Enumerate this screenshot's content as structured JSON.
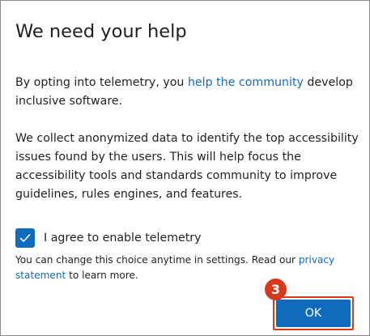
{
  "dialog": {
    "title": "We need your help",
    "paragraph1": {
      "before": "By opting into telemetry, you ",
      "link": "help the community",
      "after": " develop inclusive software."
    },
    "paragraph2": "We collect anonymized data to identify the top accessibility issues found by the users. This will help focus the accessibility tools and standards community to improve guidelines, rules engines, and features.",
    "checkbox": {
      "label": "I agree to enable telemetry",
      "checked": true
    },
    "note": {
      "before": "You can change this choice anytime in settings. Read our ",
      "link": "privacy statement",
      "after": " to learn more."
    },
    "step_badge": "3",
    "ok_button": "OK"
  },
  "colors": {
    "accent": "#0f6cbd",
    "highlight": "#d9391b",
    "text": "#1f1f1f",
    "background": "#ffffff"
  },
  "icons": {
    "checkbox_mark": "checkmark-icon"
  }
}
